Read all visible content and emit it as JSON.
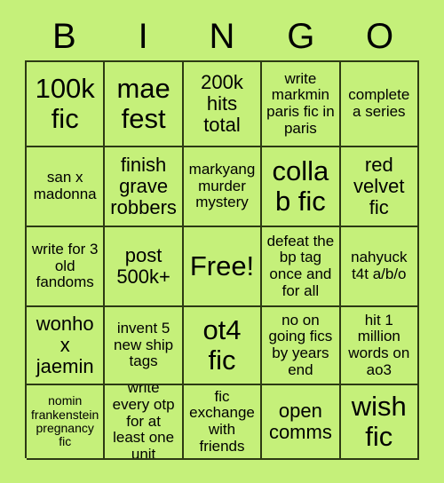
{
  "card": {
    "title_letters": [
      "B",
      "I",
      "N",
      "G",
      "O"
    ],
    "background_color": "#c5f07a",
    "grid_line_color": "#2d3a14",
    "text_color": "#000000",
    "rows": [
      [
        {
          "text": "100k fic",
          "size": "xl"
        },
        {
          "text": "mae fest",
          "size": "xl"
        },
        {
          "text": "200k hits total",
          "size": "md"
        },
        {
          "text": "write markmin paris fic in paris",
          "size": "sm"
        },
        {
          "text": "complete a series",
          "size": "sm"
        }
      ],
      [
        {
          "text": "san x madonna",
          "size": "sm"
        },
        {
          "text": "finish grave robbers",
          "size": "md"
        },
        {
          "text": "markyang murder mystery",
          "size": "sm"
        },
        {
          "text": "collab fic",
          "size": "xl"
        },
        {
          "text": "red velvet fic",
          "size": "md"
        }
      ],
      [
        {
          "text": "write for 3 old fandoms",
          "size": "sm"
        },
        {
          "text": "post 500k+",
          "size": "md"
        },
        {
          "text": "Free!",
          "size": "xl"
        },
        {
          "text": "defeat the bp tag once and for all",
          "size": "sm"
        },
        {
          "text": "nahyuck t4t a/b/o",
          "size": "sm"
        }
      ],
      [
        {
          "text": "wonho x jaemin",
          "size": "md"
        },
        {
          "text": "invent 5 new ship tags",
          "size": "sm"
        },
        {
          "text": "ot4 fic",
          "size": "xl"
        },
        {
          "text": "no on going fics by years end",
          "size": "sm"
        },
        {
          "text": "hit 1 million words on ao3",
          "size": "sm"
        }
      ],
      [
        {
          "text": "nomin frankenstein pregnancy fic",
          "size": "xs"
        },
        {
          "text": "write every otp for at least one unit",
          "size": "sm"
        },
        {
          "text": "fic exchange with friends",
          "size": "sm"
        },
        {
          "text": "open comms",
          "size": "md"
        },
        {
          "text": "wish fic",
          "size": "xl"
        }
      ]
    ]
  }
}
